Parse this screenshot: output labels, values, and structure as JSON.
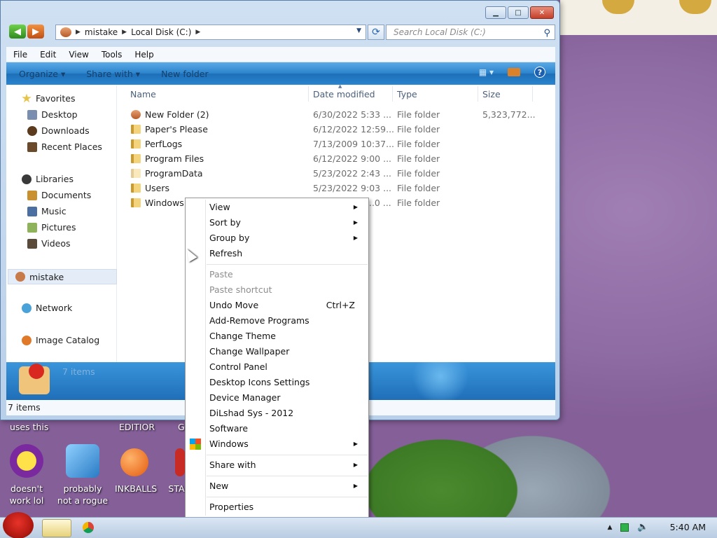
{
  "window": {
    "breadcrumb": [
      "mistake",
      "Local Disk (C:)"
    ],
    "search_placeholder": "Search Local Disk (C:)",
    "menu": [
      "File",
      "Edit",
      "View",
      "Tools",
      "Help"
    ],
    "commands": {
      "organize": "Organize",
      "share_with": "Share with",
      "new_folder": "New folder"
    },
    "columns": [
      "Name",
      "Date modified",
      "Type",
      "Size"
    ],
    "files": [
      {
        "name": "New Folder (2)",
        "date": "6/30/2022 5:33 ...",
        "type": "File folder",
        "size": "5,323,772..."
      },
      {
        "name": "Paper's Please",
        "date": "6/12/2022 12:59...",
        "type": "File folder",
        "size": ""
      },
      {
        "name": "PerfLogs",
        "date": "7/13/2009 10:37...",
        "type": "File folder",
        "size": ""
      },
      {
        "name": "Program Files",
        "date": "6/12/2022 9:00 ...",
        "type": "File folder",
        "size": ""
      },
      {
        "name": "ProgramData",
        "date": "5/23/2022 2:43 ...",
        "type": "File folder",
        "size": ""
      },
      {
        "name": "Users",
        "date": "5/23/2022 9:03 ...",
        "type": "File folder",
        "size": ""
      },
      {
        "name": "Windows",
        "date": "...0 ...",
        "type": "File folder",
        "size": ""
      }
    ],
    "nav": {
      "favorites": "Favorites",
      "desktop": "Desktop",
      "downloads": "Downloads",
      "recent": "Recent Places",
      "libraries": "Libraries",
      "documents": "Documents",
      "music": "Music",
      "pictures": "Pictures",
      "videos": "Videos",
      "mistake": "mistake",
      "network": "Network",
      "image_catalog": "Image Catalog"
    },
    "details_count": "7 items",
    "status": "7 items"
  },
  "desktop": {
    "top_labels": [
      "uses this",
      "EDITIOR",
      "G"
    ],
    "icons": [
      {
        "label1": "doesn't",
        "label2": "work lol"
      },
      {
        "label1": "probably",
        "label2": "not a rogue"
      },
      {
        "label1": "INKBALLS",
        "label2": ""
      },
      {
        "label1": "STA",
        "label2": ""
      }
    ]
  },
  "context_menu": {
    "items": [
      {
        "label": "View",
        "sub": "▶"
      },
      {
        "label": "Sort by",
        "sub": "▶"
      },
      {
        "label": "Group by",
        "sub": "▶"
      },
      {
        "label": "Refresh"
      },
      {
        "label": "Paste"
      },
      {
        "label": "Paste shortcut"
      },
      {
        "label": "Undo Move",
        "shortcut": "Ctrl+Z"
      },
      {
        "label": "Add-Remove Programs"
      },
      {
        "label": "Change Theme"
      },
      {
        "label": "Change Wallpaper"
      },
      {
        "label": "Control Panel"
      },
      {
        "label": "Desktop Icons Settings"
      },
      {
        "label": "Device Manager"
      },
      {
        "label": "DiLshad Sys - 2012"
      },
      {
        "label": "Software"
      },
      {
        "label": "Windows",
        "sub": "▶"
      },
      {
        "label": "Share with",
        "sub": "▶"
      },
      {
        "label": "New",
        "sub": "▶"
      },
      {
        "label": "Properties"
      }
    ]
  },
  "taskbar": {
    "clock": "5:40 AM"
  }
}
